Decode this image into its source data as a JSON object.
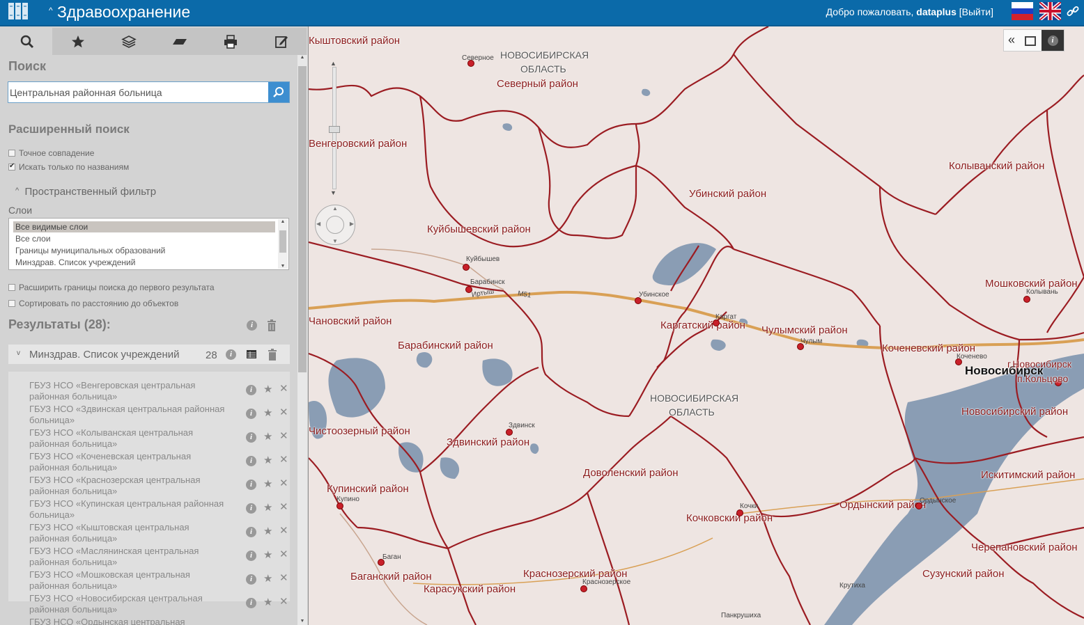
{
  "header": {
    "app_title": "Здравоохранение",
    "welcome_prefix": "Добро пожаловать, ",
    "username": "dataplus",
    "logout_label": "[Выйти]",
    "colors": {
      "bar": "#0b6aa9"
    },
    "icons": [
      "app-icon",
      "flag-ru-icon",
      "flag-gb-icon",
      "link-icon"
    ]
  },
  "sidebar": {
    "tabs": [
      {
        "name": "search",
        "icon": "search-icon",
        "active": true
      },
      {
        "name": "favorites",
        "icon": "star-icon"
      },
      {
        "name": "layers",
        "icon": "layers-icon"
      },
      {
        "name": "areas",
        "icon": "area-icon"
      },
      {
        "name": "print",
        "icon": "print-icon"
      },
      {
        "name": "edit",
        "icon": "edit-icon"
      }
    ],
    "search_title": "Поиск",
    "search_value": "Центральная районная больница",
    "advanced_title": "Расширенный поиск",
    "exact_match": {
      "label": "Точное совпадение",
      "checked": false
    },
    "names_only": {
      "label": "Искать только по названиям",
      "checked": true
    },
    "spatial_filter": "Пространственный фильтр",
    "layers_label": "Слои",
    "layers": [
      {
        "label": "Все видимые слои",
        "selected": true
      },
      {
        "label": "Все слои",
        "selected": false
      },
      {
        "label": "Границы муниципальных образований",
        "selected": false
      },
      {
        "label": "Минздрав. Список учреждений",
        "selected": false
      }
    ],
    "extend_bounds": {
      "label": "Расширить границы поиска до первого результата",
      "checked": false
    },
    "sort_distance": {
      "label": "Сортировать по расстоянию до объектов",
      "checked": false
    },
    "results_title": "Результаты (28):",
    "group": {
      "label": "Минздрав. Список учреждений",
      "count": "28"
    },
    "results": [
      "ГБУЗ НСО «Венгеровская центральная районная больница»",
      "ГБУЗ НСО «Здвинская центральная районная больница»",
      "ГБУЗ НСО «Колыванская центральная районная больница»",
      "ГБУЗ НСО «Коченевская центральная районная больница»",
      "ГБУЗ НСО «Краснозерская центральная районная больница»",
      "ГБУЗ НСО «Купинская центральная районная больница»",
      "ГБУЗ НСО «Кыштовская центральная районная больница»",
      "ГБУЗ НСО «Маслянинская центральная районная больница»",
      "ГБУЗ НСО «Мошковская центральная районная больница»",
      "ГБУЗ НСО «Новосибирская центральная районная больница»",
      "ГБУЗ НСО «Ордынская центральная"
    ]
  },
  "map": {
    "districts": [
      "Кыштовский район",
      "Северный район",
      "Венгеровский район",
      "Убинский район",
      "Колыванский район",
      "Куйбышевский район",
      "Мошковский район",
      "Чановский район",
      "Каргатский район",
      "Чулымский район",
      "Коченевский район",
      "Барабинский район",
      "Новосибирский район",
      "Чистоозерный район",
      "Здвинский район",
      "Доволенский район",
      "Купинский район",
      "Искитимский район",
      "Ордынский район",
      "Кочковский район",
      "Баганский район",
      "Краснозерский район",
      "Карасукский район",
      "Черепановский район",
      "Сузунский район"
    ],
    "region_labels": [
      "НОВОСИБИРСКАЯ",
      "ОБЛАСТЬ",
      "НОВОСИБИРСКАЯ",
      "ОБЛАСТЬ"
    ],
    "towns": [
      "Северное",
      "Куйбышев",
      "Барабинск",
      "Убинское",
      "Каргат",
      "Чулым",
      "Коченево",
      "Здвинск",
      "Купино",
      "Кочки",
      "Баган",
      "Краснозерское",
      "Крутиха",
      "Панкрушиха",
      "Ордынское",
      "Колывань"
    ],
    "city": "Новосибирск",
    "city_partial": [
      "г.Новосибирск",
      "п.Кольцово"
    ],
    "highway": "М51",
    "river": "Иртыш",
    "colors": {
      "boundary": "#9b1c22",
      "land": "#eee5e2",
      "water": "#8a9db4",
      "road": "#d9a055"
    }
  }
}
